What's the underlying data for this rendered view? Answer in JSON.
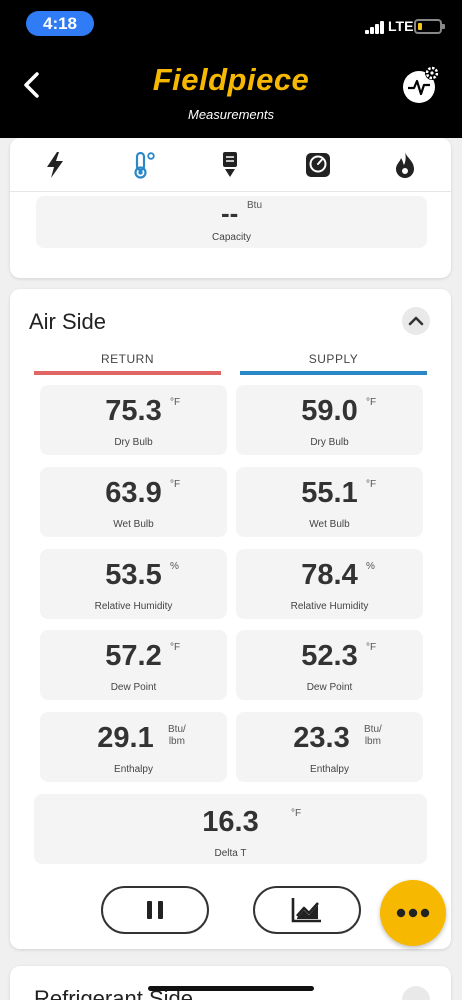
{
  "status_bar": {
    "time": "4:18",
    "network": "LTE"
  },
  "header": {
    "brand": "Fieldpiece",
    "subtitle": "Measurements"
  },
  "tabs": [
    {
      "icon": "lightning-icon"
    },
    {
      "icon": "thermometer-icon",
      "active": true
    },
    {
      "icon": "filter-icon"
    },
    {
      "icon": "gauge-icon"
    },
    {
      "icon": "flame-icon"
    }
  ],
  "capacity": {
    "value": "--",
    "unit": "Btu",
    "label": "Capacity"
  },
  "air_side": {
    "title": "Air Side",
    "return_label": "RETURN",
    "supply_label": "SUPPLY",
    "return_color": "#e06666",
    "supply_color": "#2b88c8",
    "rows": [
      {
        "label": "Dry Bulb",
        "return": "75.3",
        "supply": "59.0",
        "unit": "°F"
      },
      {
        "label": "Wet Bulb",
        "return": "63.9",
        "supply": "55.1",
        "unit": "°F"
      },
      {
        "label": "Relative Humidity",
        "return": "53.5",
        "supply": "78.4",
        "unit": "%"
      },
      {
        "label": "Dew Point",
        "return": "57.2",
        "supply": "52.3",
        "unit": "°F"
      },
      {
        "label": "Enthalpy",
        "return": "29.1",
        "supply": "23.3",
        "unit_line1": "Btu/",
        "unit_line2": "lbm"
      }
    ],
    "delta_t": {
      "value": "16.3",
      "unit": "°F",
      "label": "Delta T"
    }
  },
  "refrigerant_side": {
    "title": "Refrigerant Side"
  },
  "colors": {
    "accent": "#f6b800",
    "header_bg": "#000000"
  }
}
